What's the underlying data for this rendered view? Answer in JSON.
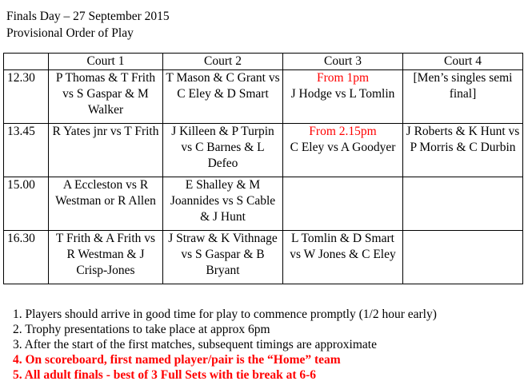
{
  "header": {
    "title": "Finals Day – 27 September 2015",
    "subtitle": "Provisional Order of Play"
  },
  "table": {
    "columns": [
      "",
      "Court 1",
      "Court 2",
      "Court 3",
      "Court 4"
    ],
    "rows": [
      {
        "time": "12.30",
        "court1": "P Thomas & T Frith vs S Gaspar & M Walker",
        "court2": "T Mason & C Grant vs C Eley & D Smart",
        "court3_note": "From 1pm",
        "court3": "J Hodge vs L Tomlin",
        "court4": "[Men’s singles semi final]"
      },
      {
        "time": "13.45",
        "court1": "R Yates jnr vs T Frith",
        "court2": "J Killeen & P Turpin vs C Barnes & L Defeo",
        "court3_note": "From 2.15pm",
        "court3": "C Eley vs A Goodyer",
        "court4": "J Roberts & K Hunt vs P Morris & C Durbin"
      },
      {
        "time": "15.00",
        "court1": "A Eccleston vs R Westman or R Allen",
        "court2": "E Shalley & M Joannides vs S Cable & J Hunt",
        "court3_note": "",
        "court3": "",
        "court4": ""
      },
      {
        "time": "16.30",
        "court1": "T Frith & A Frith vs R Westman & J Crisp-Jones",
        "court2": "J Straw & K Vithnage vs S Gaspar & B Bryant",
        "court3_note": "",
        "court3": "L Tomlin & D Smart vs W Jones & C Eley",
        "court4": ""
      }
    ]
  },
  "notes": [
    "1. Players should arrive in good time for play to commence promptly (1/2 hour early)",
    "2. Trophy presentations to take place at approx 6pm",
    "3. After the start of the first matches, subsequent timings are approximate",
    "4. On scoreboard, first named player/pair is the “Home” team",
    "5. All adult finals - best of 3 Full Sets with tie break at 6-6"
  ],
  "colors": {
    "highlight": "#ff0000",
    "text": "#000000",
    "background": "#ffffff"
  }
}
